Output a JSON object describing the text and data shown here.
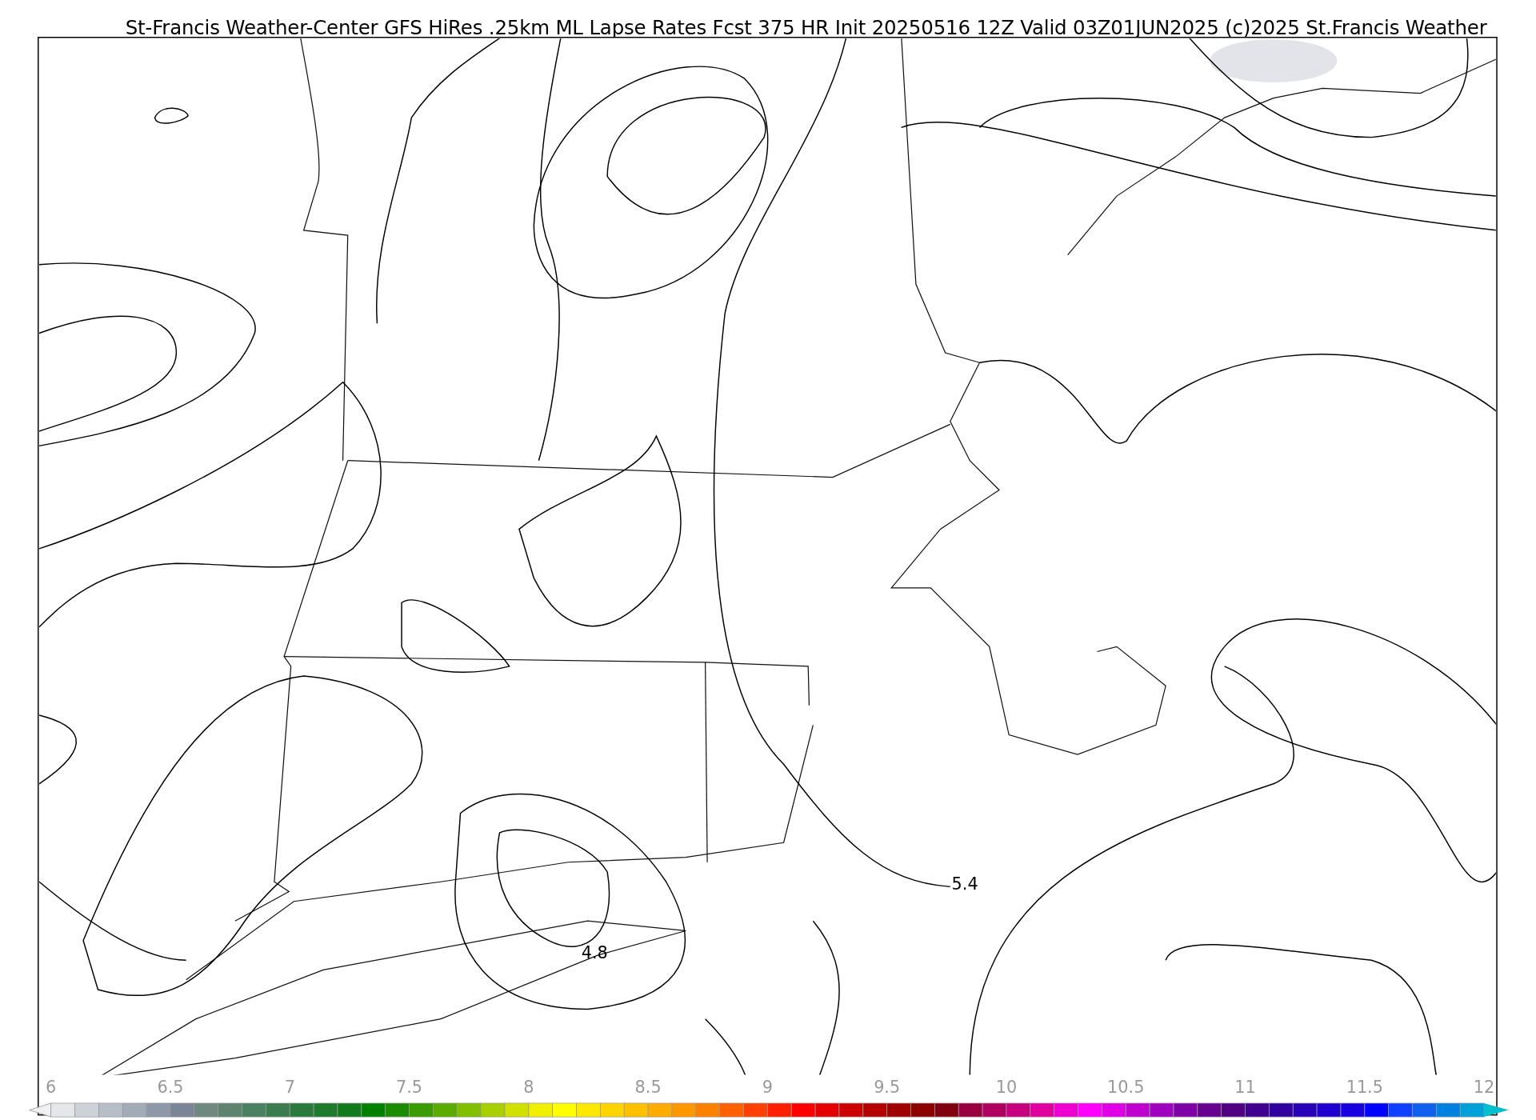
{
  "title": "St-Francis Weather-Center GFS HiRes .25km ML Lapse Rates  Fcst 375 HR Init 20250516 12Z  Valid 03Z01JUN2025    (c)2025 St.Francis Weather",
  "map": {
    "contour_labels": [
      {
        "text": "5.4",
        "kind": "east"
      },
      {
        "text": "4.8",
        "kind": "west"
      }
    ]
  },
  "colorbar": {
    "ticks": [
      "6",
      "6.5",
      "7",
      "7.5",
      "8",
      "8.5",
      "9",
      "9.5",
      "10",
      "10.5",
      "11",
      "11.5",
      "12"
    ],
    "segments": [
      {
        "color": "#e4e6ea"
      },
      {
        "color": "#cdd1d8"
      },
      {
        "color": "#b8bec8"
      },
      {
        "color": "#a3abb8"
      },
      {
        "color": "#8f98a8"
      },
      {
        "color": "#7a8698"
      },
      {
        "color": "#6f8880"
      },
      {
        "color": "#5e8470"
      },
      {
        "color": "#4b8060"
      },
      {
        "color": "#3a7c4e"
      },
      {
        "color": "#2a7a3e"
      },
      {
        "color": "#1e7a2c"
      },
      {
        "color": "#107a1c"
      },
      {
        "color": "#008000"
      },
      {
        "color": "#1a8c00"
      },
      {
        "color": "#3a9c00"
      },
      {
        "color": "#5aac00"
      },
      {
        "color": "#80c000"
      },
      {
        "color": "#a8d000"
      },
      {
        "color": "#d0e000"
      },
      {
        "color": "#f0f000"
      },
      {
        "color": "#ffff00"
      },
      {
        "color": "#ffe800"
      },
      {
        "color": "#ffd400"
      },
      {
        "color": "#ffc000"
      },
      {
        "color": "#ffac00"
      },
      {
        "color": "#ff9800"
      },
      {
        "color": "#ff8000"
      },
      {
        "color": "#ff6000"
      },
      {
        "color": "#ff4000"
      },
      {
        "color": "#ff2000"
      },
      {
        "color": "#ff0000"
      },
      {
        "color": "#e40000"
      },
      {
        "color": "#cc0000"
      },
      {
        "color": "#b40000"
      },
      {
        "color": "#a00000"
      },
      {
        "color": "#8c0000"
      },
      {
        "color": "#800010"
      },
      {
        "color": "#980040"
      },
      {
        "color": "#b00060"
      },
      {
        "color": "#c80080"
      },
      {
        "color": "#e000a0"
      },
      {
        "color": "#f000d0"
      },
      {
        "color": "#ff00ff"
      },
      {
        "color": "#e000e8"
      },
      {
        "color": "#c000d0"
      },
      {
        "color": "#a000c0"
      },
      {
        "color": "#8000a8"
      },
      {
        "color": "#680090"
      },
      {
        "color": "#500080"
      },
      {
        "color": "#400090"
      },
      {
        "color": "#3000a0"
      },
      {
        "color": "#2800b8"
      },
      {
        "color": "#2000d0"
      },
      {
        "color": "#1800e0"
      },
      {
        "color": "#0000ff"
      },
      {
        "color": "#1040ff"
      },
      {
        "color": "#1060f0"
      },
      {
        "color": "#0080e0"
      },
      {
        "color": "#00a0d8"
      }
    ]
  }
}
